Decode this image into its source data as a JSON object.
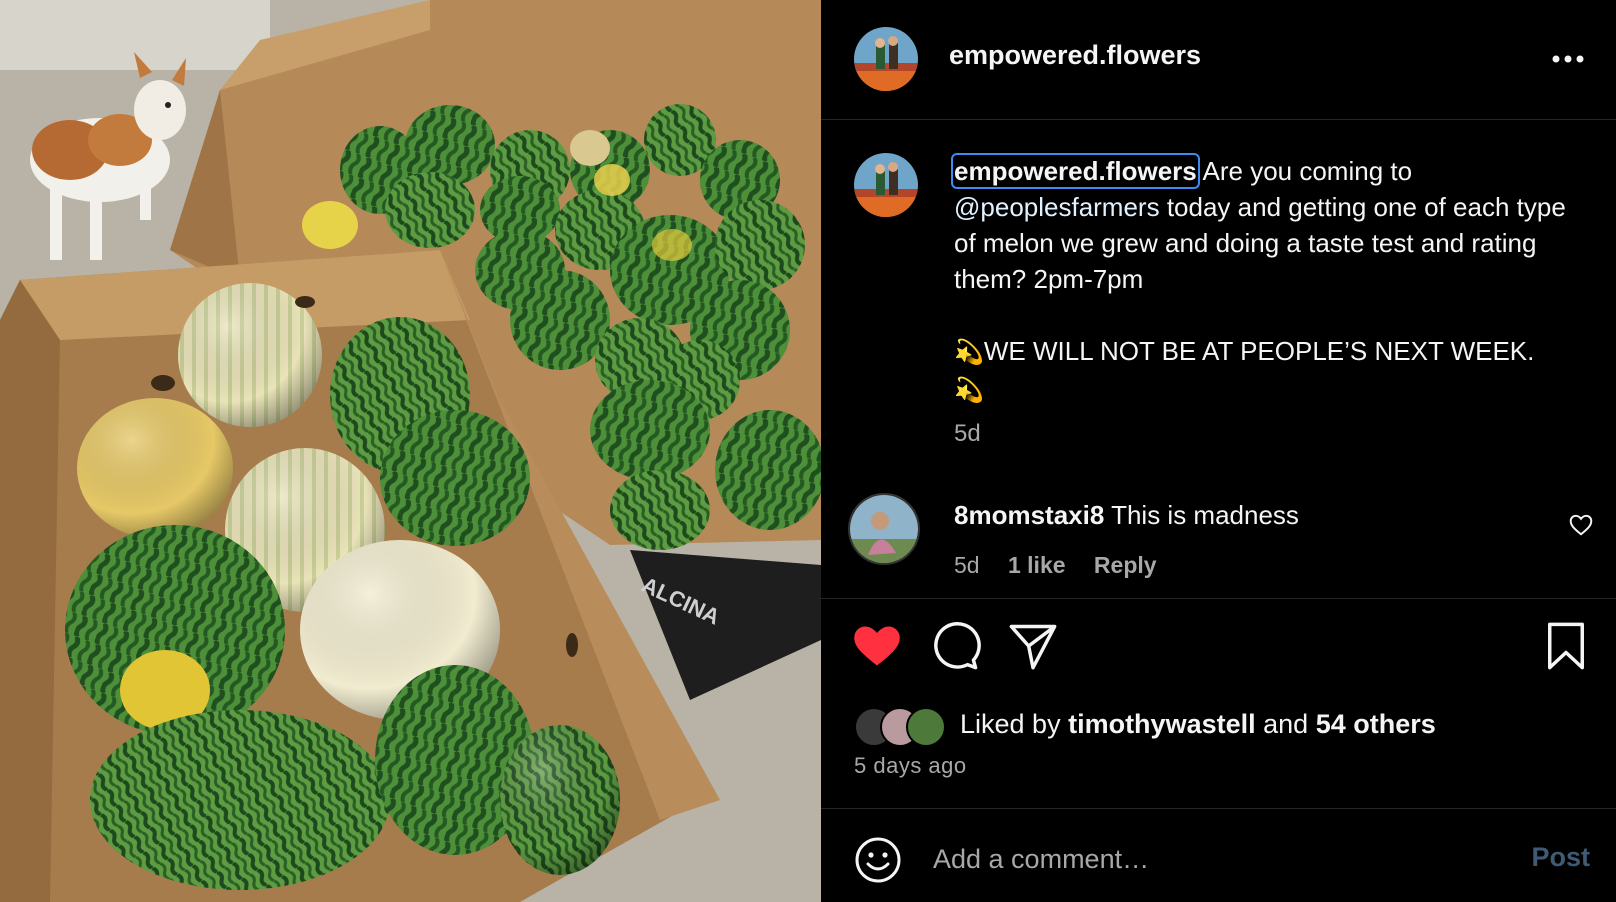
{
  "photo": {
    "alt_icon": "melon-boxes-photo",
    "box_print": "ALCINA"
  },
  "post": {
    "username": "empowered.flowers",
    "more_icon": "more-horizontal-icon"
  },
  "caption": {
    "username": "empowered.flowers",
    "text_1": " Are you coming to ",
    "mention": "@peoplesfarmers",
    "text_2": " today and getting one of each type of melon we grew and doing a taste test and rating them? 2pm-7pm\n\n",
    "emoji_1": "💫",
    "text_3": "WE WILL NOT BE AT PEOPLE’S NEXT WEEK.\n",
    "emoji_2": "💫",
    "time": "5d"
  },
  "comment": {
    "username": "8momstaxi8",
    "text": "This is madness",
    "time": "5d",
    "likes": "1 like",
    "reply": "Reply"
  },
  "likes": {
    "prefix": "Liked by ",
    "user": "timothywastell",
    "middle": " and ",
    "others": "54 others"
  },
  "date": "5 days ago",
  "composer": {
    "placeholder": "Add a comment…",
    "post_label": "Post"
  },
  "colors": {
    "like_red": "#ff3040",
    "mention": "#e0f1ff",
    "post_disabled": "#3f5a75",
    "muted": "#a8a8a8"
  }
}
